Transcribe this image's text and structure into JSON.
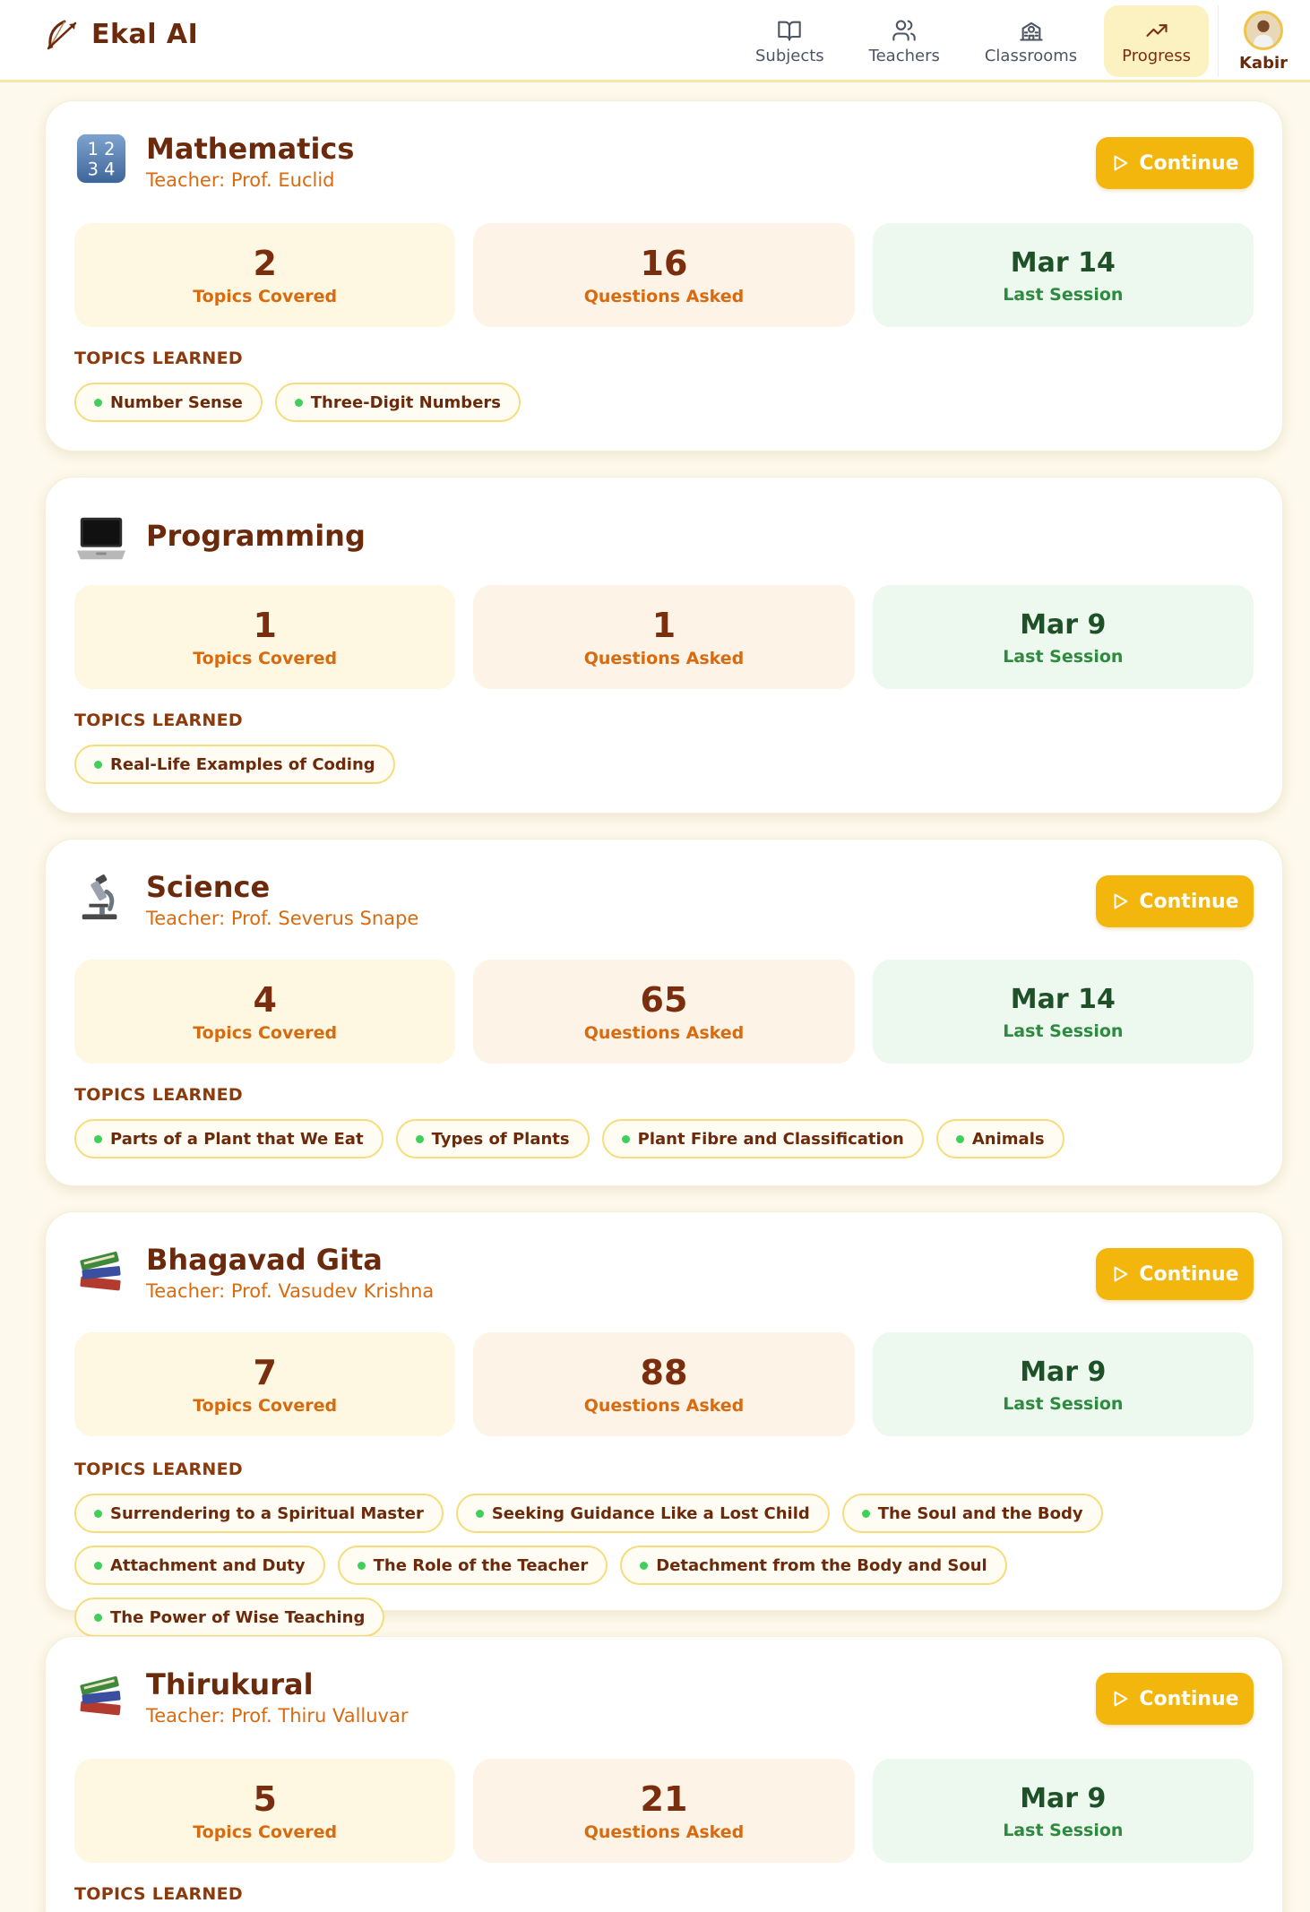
{
  "app": {
    "name": "Ekal AI"
  },
  "nav": {
    "items": [
      {
        "label": "Subjects",
        "icon": "book-open-icon"
      },
      {
        "label": "Teachers",
        "icon": "users-icon"
      },
      {
        "label": "Classrooms",
        "icon": "school-icon"
      },
      {
        "label": "Progress",
        "icon": "trending-up-icon",
        "active": true
      }
    ],
    "profile": {
      "name": "Kabir"
    }
  },
  "labels": {
    "continue": "Continue",
    "topics_covered": "Topics Covered",
    "questions_asked": "Questions Asked",
    "last_session": "Last Session",
    "topics_learned": "TOPICS LEARNED"
  },
  "colors": {
    "accent": "#f3b60d",
    "brand_text": "#6b2a0c",
    "teacher_text": "#d86a10",
    "session_text": "#2e8a3e",
    "chip_dot": "#3fcf5a",
    "background": "#fdf9ec"
  },
  "subjects": [
    {
      "title": "Mathematics",
      "icon": "numbers-1234-icon",
      "teacher": "Teacher: Prof. Euclid",
      "has_continue": true,
      "topics_covered": "2",
      "questions_asked": "16",
      "last_session": "Mar 14",
      "topics": [
        "Number Sense",
        "Three-Digit Numbers"
      ]
    },
    {
      "title": "Programming",
      "icon": "laptop-icon",
      "teacher": "",
      "has_continue": false,
      "topics_covered": "1",
      "questions_asked": "1",
      "last_session": "Mar 9",
      "topics": [
        "Real-Life Examples of Coding"
      ]
    },
    {
      "title": "Science",
      "icon": "microscope-icon",
      "teacher": "Teacher: Prof. Severus Snape",
      "has_continue": true,
      "topics_covered": "4",
      "questions_asked": "65",
      "last_session": "Mar 14",
      "topics": [
        "Parts of a Plant that We Eat",
        "Types of Plants",
        "Plant Fibre and Classification",
        "Animals"
      ]
    },
    {
      "title": "Bhagavad Gita",
      "icon": "books-icon",
      "teacher": "Teacher: Prof. Vasudev Krishna",
      "has_continue": true,
      "topics_covered": "7",
      "questions_asked": "88",
      "last_session": "Mar 9",
      "topics": [
        "Surrendering to a Spiritual Master",
        "Seeking Guidance Like a Lost Child",
        "The Soul and the Body",
        "Attachment and Duty",
        "The Role of the Teacher",
        "Detachment from the Body and Soul",
        "The Power of Wise Teaching"
      ]
    },
    {
      "title": "Thirukural",
      "icon": "books-icon",
      "teacher": "Teacher: Prof. Thiru Valluvar",
      "has_continue": true,
      "topics_covered": "5",
      "questions_asked": "21",
      "last_session": "Mar 9",
      "topics": []
    }
  ]
}
